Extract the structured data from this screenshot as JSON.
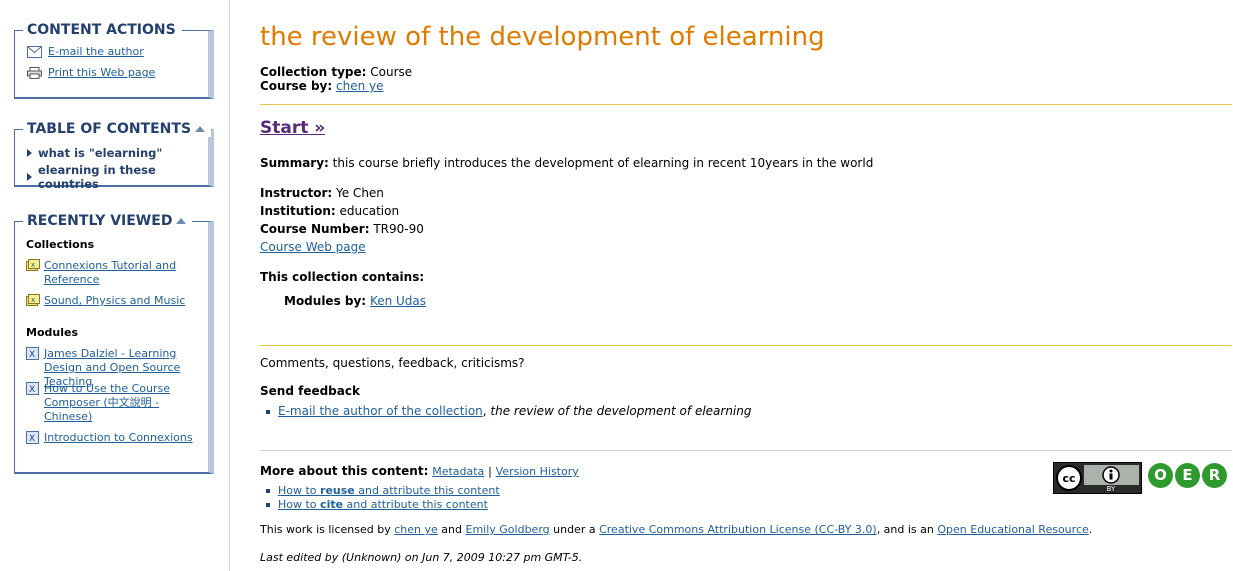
{
  "sidebar": {
    "content_actions": {
      "title": "CONTENT ACTIONS",
      "items": [
        {
          "label": "E-mail the author",
          "icon": "envelope-icon"
        },
        {
          "label": "Print this Web page",
          "icon": "printer-icon"
        }
      ]
    },
    "toc": {
      "title": "TABLE OF CONTENTS",
      "items": [
        "what is \"elearning\"",
        "elearning in these countries"
      ]
    },
    "recently_viewed": {
      "title": "RECENTLY VIEWED",
      "collections_label": "Collections",
      "collections": [
        "Connexions Tutorial and Reference",
        "Sound, Physics and Music"
      ],
      "modules_label": "Modules",
      "modules": [
        "James Dalziel - Learning Design and Open Source Teaching",
        "How to Use the Course Composer (中文說明 - Chinese)",
        "Introduction to Connexions"
      ]
    }
  },
  "main": {
    "title": "the review of the development of elearning",
    "collection_type_label": "Collection type:",
    "collection_type": "Course",
    "course_by_label": "Course by:",
    "course_by": "chen ye",
    "start": "Start »",
    "summary_label": "Summary:",
    "summary": "this course briefly introduces the development of elearning in recent 10years in the world",
    "instructor_label": "Instructor:",
    "instructor": "Ye Chen",
    "institution_label": "Institution:",
    "institution": "education",
    "course_number_label": "Course Number:",
    "course_number": "TR90-90",
    "course_web_page": "Course Web page",
    "contains_label": "This collection contains:",
    "modules_by_label": "Modules by:",
    "modules_by": "Ken Udas",
    "comments_prompt": "Comments, questions, feedback, criticisms?",
    "send_feedback": "Send feedback",
    "feedback_link": "E-mail the author of the collection",
    "feedback_title": "the review of the development of elearning",
    "more_about_label": "More about this content:",
    "metadata_link": "Metadata",
    "separator": "|",
    "version_history_link": "Version History",
    "reuse": {
      "pre": "How to ",
      "bold": "reuse",
      "post": " and attribute this content"
    },
    "cite": {
      "pre": "How to ",
      "bold": "cite",
      "post": " and attribute this content"
    },
    "license": {
      "pre": "This work is licensed by ",
      "author1": "chen ye",
      "and": " and ",
      "author2": "Emily Goldberg",
      "under": " under a ",
      "license_link": "Creative Commons Attribution License (CC-BY 3.0)",
      "mid": ", and is an ",
      "oer_link": "Open Educational Resource",
      "end": "."
    },
    "last_edited": "Last edited by (Unknown) on Jun 7, 2009 10:27 pm GMT-5.",
    "cc_badge": {
      "cc": "cc",
      "by": "BY"
    },
    "oer_letters": [
      "O",
      "E",
      "R"
    ]
  },
  "colors": {
    "title": "#e07b00",
    "link": "#1f5f9a",
    "sidebar_heading": "#24406e",
    "divider": "#e8c84a",
    "oer_green": "#2e9a2e"
  }
}
